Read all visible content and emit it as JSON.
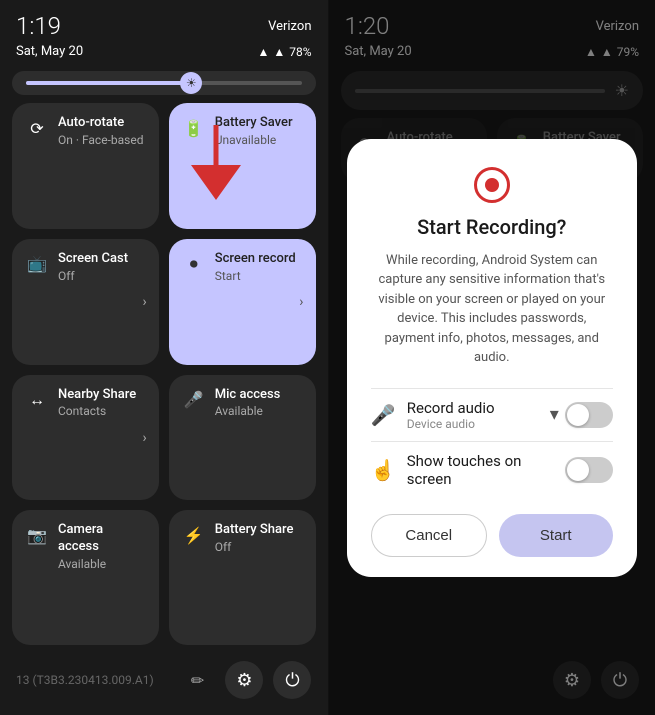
{
  "left": {
    "time": "1:19",
    "date": "Sat, May 20",
    "carrier": "Verizon",
    "battery": "78%",
    "tiles": [
      {
        "id": "auto-rotate",
        "icon": "⟳",
        "title": "Auto-rotate",
        "sub": "On · Face-based",
        "active": false,
        "chevron": false
      },
      {
        "id": "battery-saver",
        "icon": "🔋",
        "title": "Battery Saver",
        "sub": "Unavailable",
        "active": true,
        "chevron": false
      },
      {
        "id": "screen-cast",
        "icon": "📺",
        "title": "Screen Cast",
        "sub": "Off",
        "active": false,
        "chevron": true
      },
      {
        "id": "screen-record",
        "icon": "⏺",
        "title": "Screen record",
        "sub": "Start",
        "active": true,
        "chevron": true
      },
      {
        "id": "nearby-share",
        "icon": "↔",
        "title": "Nearby Share",
        "sub": "Contacts",
        "active": false,
        "chevron": true
      },
      {
        "id": "mic-access",
        "icon": "🎤",
        "title": "Mic access",
        "sub": "Available",
        "active": false,
        "chevron": false
      },
      {
        "id": "camera-access",
        "icon": "📷",
        "title": "Camera access",
        "sub": "Available",
        "active": false,
        "chevron": false
      },
      {
        "id": "battery-share",
        "icon": "⚡",
        "title": "Battery Share",
        "sub": "Off",
        "active": false,
        "chevron": false
      }
    ],
    "build_info": "13 (T3B3.230413.009.A1)",
    "settings_label": "Settings",
    "power_label": "Power"
  },
  "right": {
    "time": "1:20",
    "date": "Sat, May 20",
    "carrier": "Verizon",
    "battery": "79%",
    "partial_tiles": [
      {
        "id": "auto-rotate-r",
        "title": "Auto-rotate",
        "icon": "⟳"
      },
      {
        "id": "battery-saver-r",
        "title": "Battery Saver",
        "icon": "🔋"
      }
    ],
    "dialog": {
      "title": "Start Recording?",
      "body": "While recording, Android System can capture any sensitive information that's visible on your screen or played on your device. This includes passwords, payment info, photos, messages, and audio.",
      "options": [
        {
          "id": "record-audio",
          "icon": "🎤",
          "title": "Record audio",
          "sub": "Device audio",
          "has_dropdown": true,
          "toggle_on": false
        },
        {
          "id": "show-touches",
          "icon": "👆",
          "title": "Show touches on screen",
          "sub": "",
          "has_dropdown": false,
          "toggle_on": false
        }
      ],
      "cancel_label": "Cancel",
      "start_label": "Start"
    }
  }
}
